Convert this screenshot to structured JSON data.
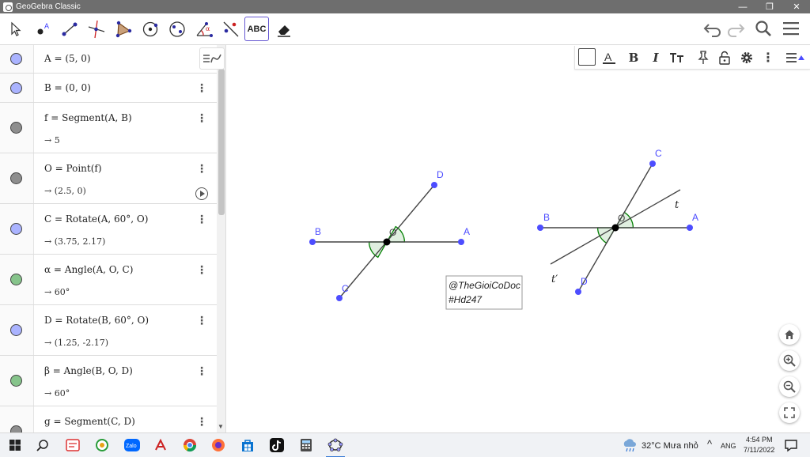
{
  "window": {
    "title": "GeoGebra Classic"
  },
  "titlebar_buttons": [
    "—",
    "❐",
    "✕"
  ],
  "toolbar": {
    "tools": [
      {
        "name": "move-tool",
        "icon": "arrow-cursor-icon"
      },
      {
        "name": "point-tool",
        "icon": "point-icon",
        "letter": "A"
      },
      {
        "name": "segment-tool",
        "icon": "segment-icon"
      },
      {
        "name": "perpendicular-line-tool",
        "icon": "perpendicular-icon"
      },
      {
        "name": "polygon-tool",
        "icon": "polygon-icon"
      },
      {
        "name": "circle-tool",
        "icon": "circle-icon"
      },
      {
        "name": "ellipse-tool",
        "icon": "ellipse-icon"
      },
      {
        "name": "angle-tool",
        "icon": "angle-icon",
        "letter": "α"
      },
      {
        "name": "reflect-tool",
        "icon": "reflect-icon"
      },
      {
        "name": "text-tool",
        "icon": "text-icon",
        "label": "ABC",
        "active": true
      },
      {
        "name": "eraser-tool",
        "icon": "eraser-icon"
      }
    ],
    "right_icons": [
      "undo-icon",
      "redo-icon",
      "search-icon",
      "menu-icon"
    ]
  },
  "algebra": {
    "rows": [
      {
        "definition": "A = (5, 0)",
        "output": "",
        "color": "#aab3ff"
      },
      {
        "definition": "B = (0, 0)",
        "output": "",
        "color": "#aab3ff"
      },
      {
        "definition": "f = Segment(A, B)",
        "output": "→ 5",
        "color": "#8e8e8e"
      },
      {
        "definition": "O = Point(f)",
        "output": "→ (2.5, 0)",
        "color": "#8e8e8e",
        "play": true
      },
      {
        "definition": "C = Rotate(A, 60°, O)",
        "output": "→ (3.75, 2.17)",
        "color": "#aab3ff"
      },
      {
        "definition": "α = Angle(A, O, C)",
        "output": "→ 60°",
        "color": "#86c48b"
      },
      {
        "definition": "D = Rotate(B, 60°, O)",
        "output": "→ (1.25, -2.17)",
        "color": "#aab3ff"
      },
      {
        "definition": "β = Angle(B, O, D)",
        "output": "→ 60°",
        "color": "#86c48b"
      },
      {
        "definition": "g = Segment(C, D)",
        "output": "",
        "color": "#8e8e8e"
      }
    ]
  },
  "graphics": {
    "labels": {
      "fig1_B": "B",
      "fig1_A": "A",
      "fig1_O": "O",
      "fig1_C": "C",
      "fig1_D": "D",
      "fig2_B": "B",
      "fig2_A": "A",
      "fig2_O": "O",
      "fig2_C": "C",
      "fig2_D": "D",
      "fig2_t": "t",
      "fig2_tprime": "t′"
    },
    "watermark": [
      "@TheGioiCoDoc",
      "#Hd247"
    ],
    "colors": {
      "point": "#4d4dff",
      "line": "#444444",
      "angle": "#007f00",
      "angle_fill": "rgba(0,127,0,0.12)"
    }
  },
  "stylebar": {
    "icons": [
      "color-swatch-icon",
      "text-color-icon",
      "bold-icon",
      "italic-icon",
      "text-size-icon",
      "pin-icon",
      "lock-icon",
      "settings-gear-icon",
      "more-vert-icon",
      "toggle-stylebar-icon"
    ],
    "bold": "B",
    "italic": "I"
  },
  "taskbar": {
    "icons": [
      "windows-start-icon",
      "search-icon",
      "app-icon-1",
      "app-icon-2",
      "zalo-icon",
      "app-icon-3",
      "chrome-icon",
      "app-icon-4",
      "store-icon",
      "tiktok-icon",
      "calculator-icon",
      "geogebra-icon"
    ],
    "zalo_label": "Zalo",
    "weather": "32°C  Mưa nhỏ",
    "language": "ANG",
    "time": "4:54 PM",
    "date": "7/11/2022"
  }
}
